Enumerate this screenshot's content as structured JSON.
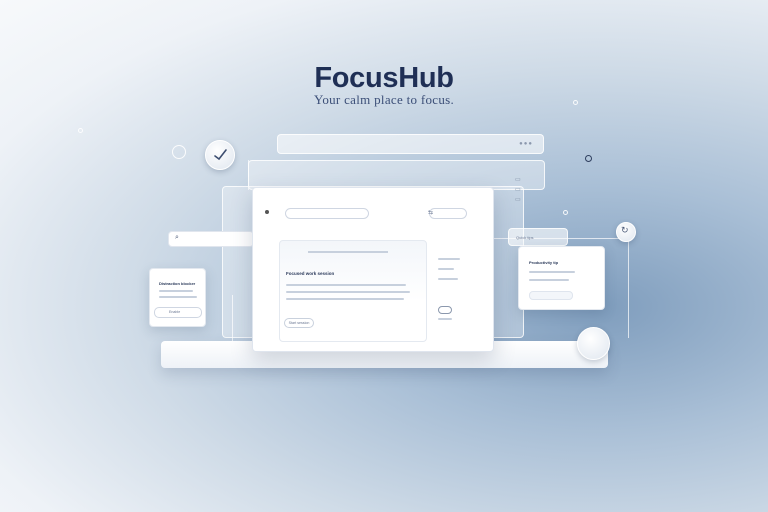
{
  "app": {
    "name": "FocusHub",
    "tagline": "Your calm place to focus."
  },
  "main_window": {
    "card": {
      "heading": "Focused work session",
      "button_label": "Start session"
    }
  },
  "left_card": {
    "title": "Distraction blocker",
    "button_label": "Enable"
  },
  "right_panel": {
    "label": "Quick tips",
    "card_title": "Productivity tip"
  },
  "colors": {
    "brand": "#1f2f55",
    "accent": "#5f84ad",
    "background": "#cfdbe7"
  }
}
